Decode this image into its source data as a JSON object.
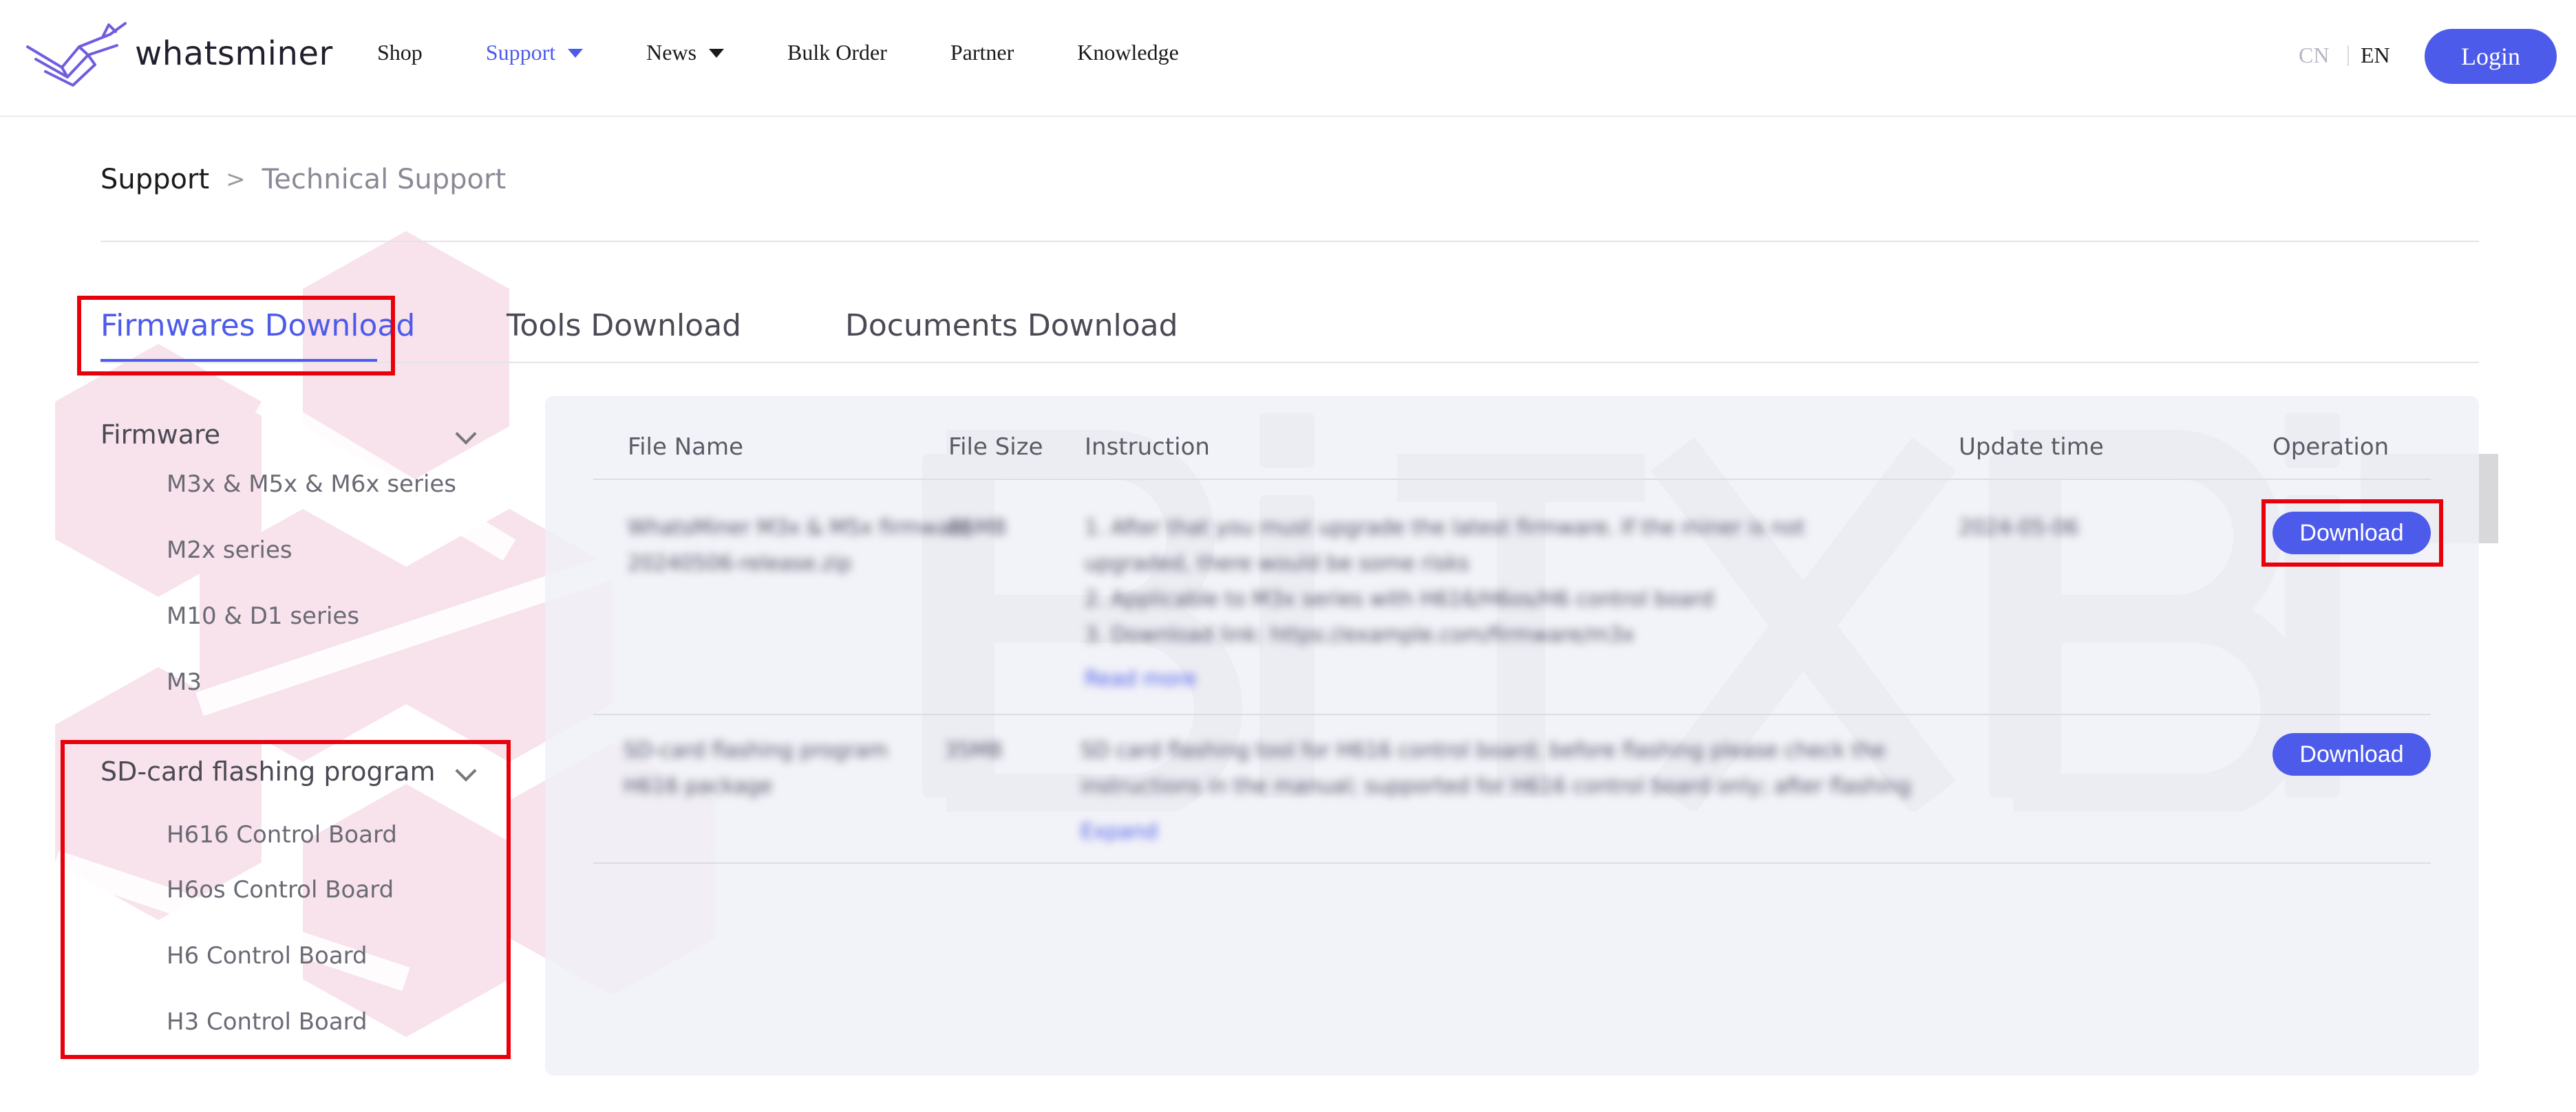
{
  "header": {
    "brand": "whatsminer",
    "nav": [
      {
        "label": "Shop",
        "dropdown": false,
        "active": false
      },
      {
        "label": "Support",
        "dropdown": true,
        "active": true
      },
      {
        "label": "News",
        "dropdown": true,
        "active": false
      },
      {
        "label": "Bulk Order",
        "dropdown": false,
        "active": false
      },
      {
        "label": "Partner",
        "dropdown": false,
        "active": false
      },
      {
        "label": "Knowledge",
        "dropdown": false,
        "active": false
      }
    ],
    "lang_cn": "CN",
    "lang_en": "EN",
    "login_label": "Login"
  },
  "breadcrumb": {
    "home": "Support",
    "separator": ">",
    "current": "Technical Support"
  },
  "tabs": [
    {
      "label": "Firmwares Download",
      "active": true
    },
    {
      "label": "Tools Download",
      "active": false
    },
    {
      "label": "Documents Download",
      "active": false
    }
  ],
  "sidebar": {
    "groups": [
      {
        "title": "Firmware",
        "items": [
          "M3x & M5x & M6x series",
          "M2x series",
          "M10 & D1 series",
          "M3"
        ]
      },
      {
        "title": "SD-card flashing program",
        "items": [
          "H616 Control Board",
          "H6os Control Board",
          "H6 Control Board",
          "H3 Control Board"
        ]
      }
    ]
  },
  "table": {
    "headers": {
      "file_name": "File Name",
      "file_size": "File Size",
      "instruction": "Instruction",
      "update_time": "Update time",
      "operation": "Operation"
    },
    "rows": [
      {
        "file_name_lines": [
          "WhatsMiner M3x & M5x firmware",
          "20240506-release.zip"
        ],
        "file_size": "85MB",
        "instruction_lines": [
          "1. After that you must upgrade the latest firmware. If the miner is not",
          "upgraded, there would be some risks",
          "2. Applicable to M3x series with H616/H6os/H6 control board",
          "3. Download link: https://example.com/firmware/m3x"
        ],
        "instruction_link": "Read more",
        "update_time": "2024-05-06",
        "action_label": "Download"
      },
      {
        "file_name_lines": [
          "SD-card flashing program",
          "H616 package"
        ],
        "file_size": "35MB",
        "instruction_lines": [
          "SD card flashing tool for H616 control board; before flashing please check the",
          "instructions in the manual; supported for H616 control board only; after flashing"
        ],
        "instruction_link": "Expand",
        "update_time": "",
        "action_label": "Download"
      }
    ]
  },
  "watermark_text": "BITXBIT",
  "colors": {
    "accent": "#4d5bea",
    "highlight": "#e8000b",
    "panel": "#f0f1f7",
    "decor": "#e9a9c4"
  }
}
